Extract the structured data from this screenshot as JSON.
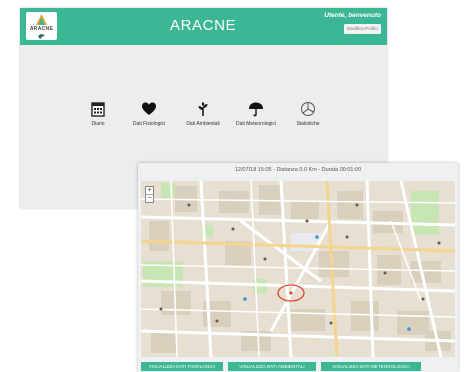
{
  "app": {
    "title": "ARACNE",
    "logo_text": "ARACNE",
    "welcome": "Utente, benvenuto",
    "profile_button": "Modifica Profilo"
  },
  "features": [
    {
      "label": "Diario",
      "icon": "calendar-icon"
    },
    {
      "label": "Dati Fisiologici",
      "icon": "heart-icon"
    },
    {
      "label": "Dati Ambientali",
      "icon": "plant-icon"
    },
    {
      "label": "Dati Meteorologici",
      "icon": "umbrella-icon"
    },
    {
      "label": "Statistiche",
      "icon": "pie-chart-icon"
    }
  ],
  "session": {
    "info": "12/07/18 15:05 - Distanza 0.0 Km - Durata 00:01:00"
  },
  "map": {
    "zoom_in": "+",
    "zoom_out": "−"
  },
  "buttons": [
    {
      "label": "VISUALIZZA DATI FISIOLOGICI"
    },
    {
      "label": "VISUALIZZA DATI AMBIENTALI"
    },
    {
      "label": "VISUALIZZA DATI METEOROLOGICI"
    }
  ],
  "colors": {
    "accent": "#3bb796",
    "background": "#ecedef"
  }
}
